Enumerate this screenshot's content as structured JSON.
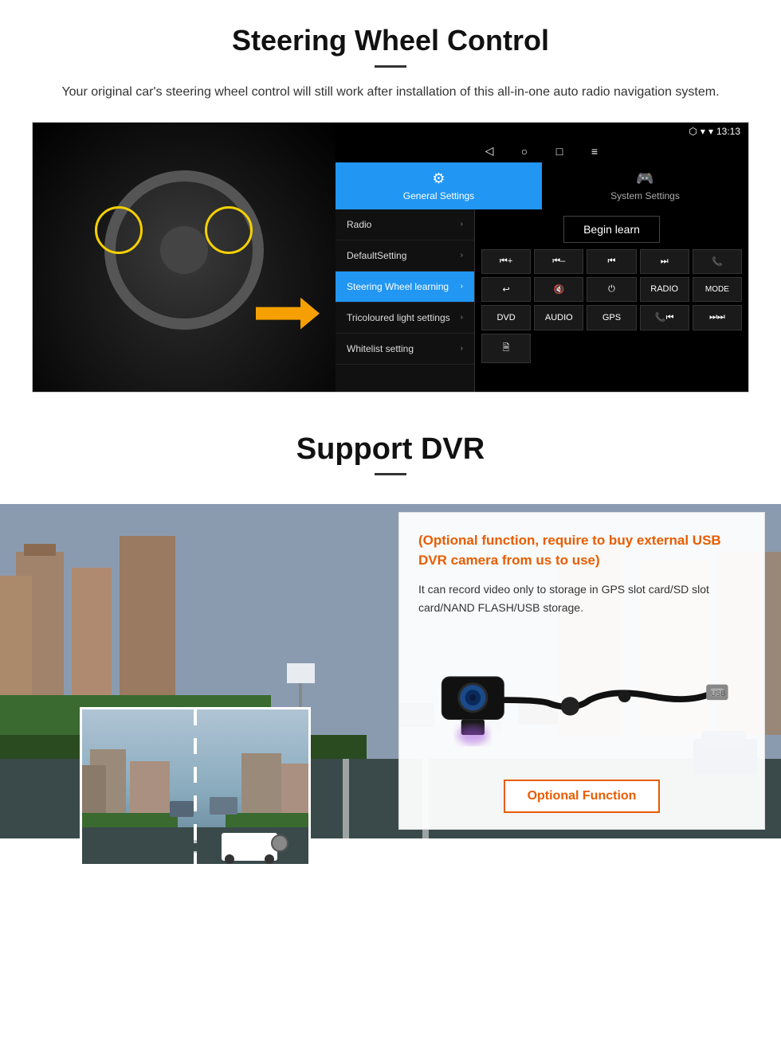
{
  "steering": {
    "title": "Steering Wheel Control",
    "subtitle": "Your original car's steering wheel control will still work after installation of this all-in-one auto radio navigation system.",
    "statusbar": {
      "time": "13:13",
      "signal": "▾",
      "wifi": "▾"
    },
    "tabs": [
      {
        "label": "General Settings",
        "icon": "⚙",
        "active": true
      },
      {
        "label": "System Settings",
        "icon": "🎮",
        "active": false
      }
    ],
    "menu_items": [
      {
        "label": "Radio",
        "active": false
      },
      {
        "label": "DefaultSetting",
        "active": false
      },
      {
        "label": "Steering Wheel learning",
        "active": true
      },
      {
        "label": "Tricoloured light settings",
        "active": false
      },
      {
        "label": "Whitelist setting",
        "active": false
      }
    ],
    "begin_learn": "Begin learn",
    "control_buttons": [
      [
        "⏮+",
        "⏮–",
        "⏮⏮",
        "⏭⏭",
        "📞"
      ],
      [
        "↩",
        "🔇",
        "⏻",
        "RADIO",
        "MODE"
      ],
      [
        "DVD",
        "AUDIO",
        "GPS",
        "📞⏮",
        "⏭⏭"
      ]
    ],
    "extra_btn": "🗎"
  },
  "dvr": {
    "title": "Support DVR",
    "optional_title": "(Optional function, require to buy external USB DVR camera from us to use)",
    "description": "It can record video only to storage in GPS slot card/SD slot card/NAND FLASH/USB storage.",
    "optional_function_label": "Optional Function"
  }
}
